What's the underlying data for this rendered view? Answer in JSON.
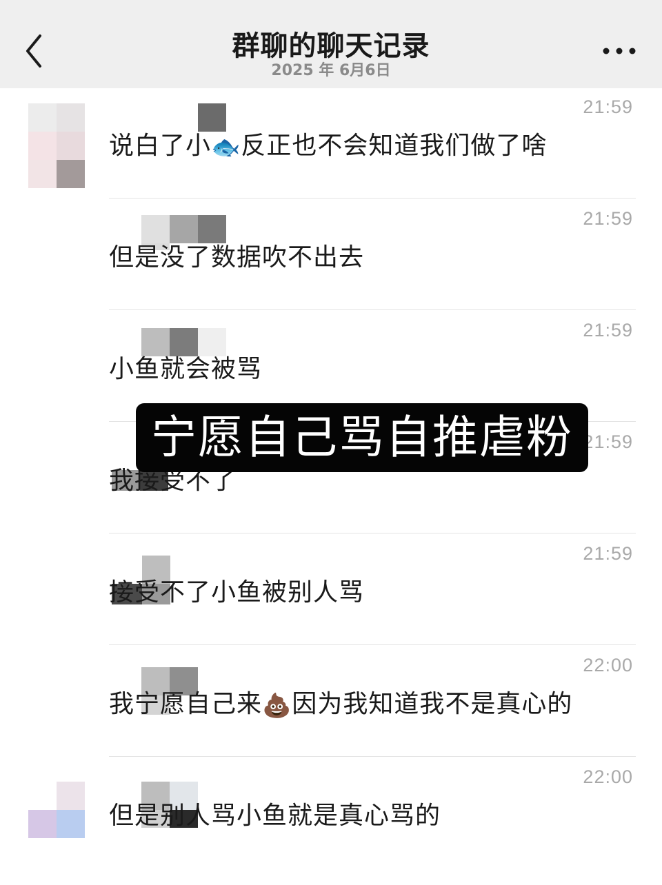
{
  "nav": {
    "title": "群聊的聊天记录",
    "date": "2025 年 6月6日",
    "back_icon": "chevron-left-icon",
    "more_icon": "ellipsis-icon"
  },
  "messages": [
    {
      "time": "21:59",
      "text_before": "说白了小",
      "emoji": "🐟",
      "text_after": "反正也不会知道我们做了啥"
    },
    {
      "time": "21:59",
      "text": "但是没了数据吹不出去"
    },
    {
      "time": "21:59",
      "text": "小鱼就会被骂"
    },
    {
      "time": "21:59",
      "text": "我接受不了"
    },
    {
      "time": "21:59",
      "text": "接受不了小鱼被别人骂"
    },
    {
      "time": "22:00",
      "text_before": "我宁愿自己来",
      "emoji": "💩",
      "text_after": "因为我知道我不是真心的"
    },
    {
      "time": "22:00",
      "text": "但是别人骂小鱼就是真心骂的"
    }
  ],
  "overlay": {
    "text": "宁愿自己骂自推虐粉"
  },
  "colors": {
    "nav_bg": "#efefef",
    "overlay_bg": "#050505",
    "overlay_text": "#ffffff",
    "time": "#a9a9a9"
  }
}
